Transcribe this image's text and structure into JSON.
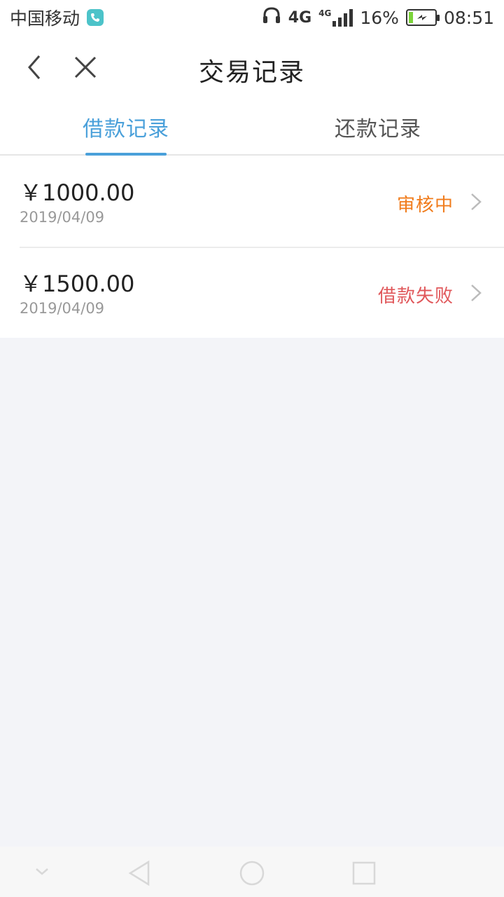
{
  "status_bar": {
    "carrier": "中国移动",
    "network_primary": "4G",
    "network_secondary": "4G",
    "battery_percent": "16%",
    "time": "08:51",
    "icons": [
      "phone-app-icon",
      "headphones-icon",
      "signal-icon",
      "battery-charging-icon"
    ]
  },
  "header": {
    "title": "交易记录",
    "back_icon": "chevron-left-icon",
    "close_icon": "close-icon"
  },
  "tabs": [
    {
      "label": "借款记录",
      "active": true
    },
    {
      "label": "还款记录",
      "active": false
    }
  ],
  "records": [
    {
      "amount": "￥1000.00",
      "date": "2019/04/09",
      "status": "审核中",
      "status_color": "#f07c1c"
    },
    {
      "amount": "￥1500.00",
      "date": "2019/04/09",
      "status": "借款失败",
      "status_color": "#e0575a"
    }
  ],
  "colors": {
    "accent": "#4aa0da",
    "pending": "#f07c1c",
    "failed": "#e0575a",
    "background": "#f3f4f8",
    "battery_level": "#7bd43a"
  },
  "nav_bar": {
    "icons": [
      "collapse-down-icon",
      "nav-back-icon",
      "nav-home-icon",
      "nav-recents-icon"
    ]
  }
}
